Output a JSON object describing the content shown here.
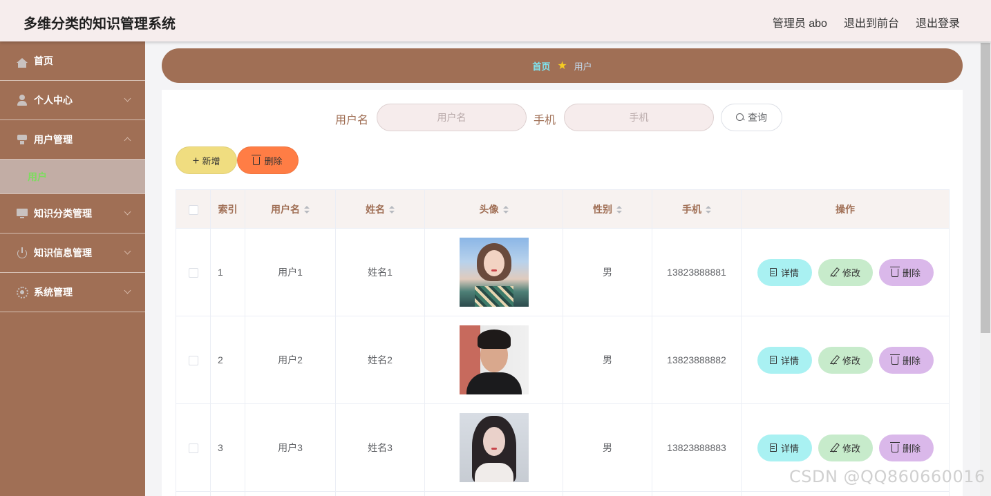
{
  "app": {
    "title": "多维分类的知识管理系统"
  },
  "header": {
    "links": [
      "管理员 abo",
      "退出到前台",
      "退出登录"
    ]
  },
  "sidebar": {
    "items": [
      {
        "label": "首页",
        "icon": "home-icon"
      },
      {
        "label": "个人中心",
        "icon": "user-icon"
      },
      {
        "label": "用户管理",
        "icon": "manage-icon",
        "expanded": true
      },
      {
        "label": "知识分类管理",
        "icon": "monitor-icon"
      },
      {
        "label": "知识信息管理",
        "icon": "power-icon"
      },
      {
        "label": "系统管理",
        "icon": "gear-icon"
      }
    ],
    "sub_item": "用户"
  },
  "breadcrumb": {
    "home": "首页",
    "current": "用户"
  },
  "search": {
    "username_label": "用户名",
    "username_placeholder": "用户名",
    "phone_label": "手机",
    "phone_placeholder": "手机",
    "query_label": "查询"
  },
  "toolbar": {
    "add_label": "新增",
    "delete_label": "删除"
  },
  "table": {
    "columns": [
      "索引",
      "用户名",
      "姓名",
      "头像",
      "性别",
      "手机",
      "操作"
    ],
    "rows": [
      {
        "index": "1",
        "username": "用户1",
        "name": "姓名1",
        "gender": "男",
        "phone": "13823888881"
      },
      {
        "index": "2",
        "username": "用户2",
        "name": "姓名2",
        "gender": "男",
        "phone": "13823888882"
      },
      {
        "index": "3",
        "username": "用户3",
        "name": "姓名3",
        "gender": "男",
        "phone": "13823888883"
      }
    ],
    "actions": {
      "detail": "详情",
      "edit": "修改",
      "delete": "删除"
    }
  },
  "watermark": "CSDN @QQ860660016",
  "colors": {
    "brand": "#a06f55",
    "add": "#f0dd80",
    "delete": "#ff7d45",
    "detail": "#a9f1f2",
    "edit": "#c7ebcb",
    "row_delete": "#dab8ea"
  }
}
